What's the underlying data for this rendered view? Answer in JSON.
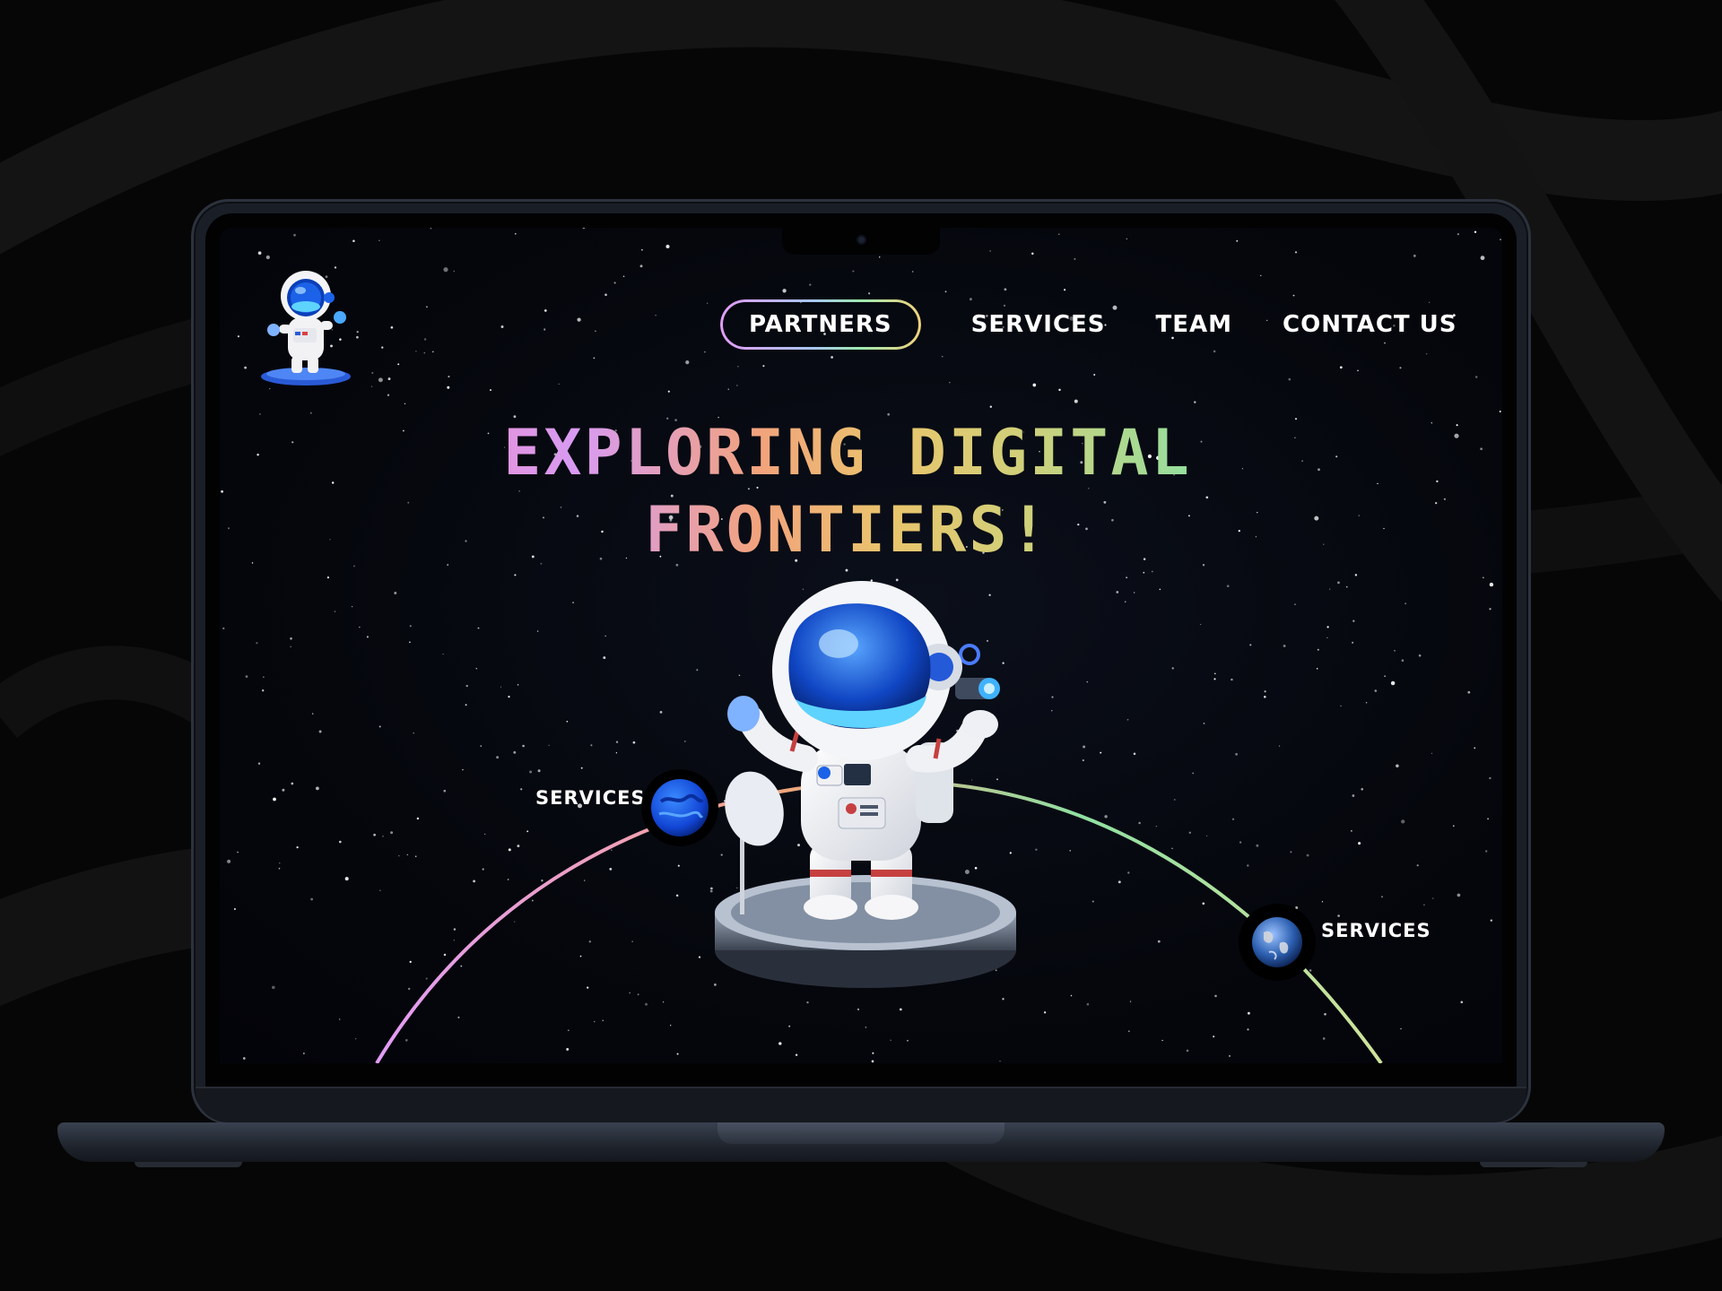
{
  "nav": {
    "items": [
      {
        "label": "PARTNERS",
        "active": true
      },
      {
        "label": "SERVICES",
        "active": false
      },
      {
        "label": "TEAM",
        "active": false
      },
      {
        "label": "CONTACT US",
        "active": false
      }
    ]
  },
  "hero": {
    "line1": "EXPLORING DIGITAL",
    "line2": "FRONTIERS!"
  },
  "orbit_nodes": [
    {
      "label": "SERVICES",
      "icon": "blue-planet-icon"
    },
    {
      "label": "SERVICES",
      "icon": "earth-planet-icon"
    }
  ],
  "colors": {
    "background": "#050505",
    "screen": "#05070d",
    "orbit_gradient": [
      "#e29cf6",
      "#f2a37c",
      "#8fe0a2",
      "#cfe39a"
    ],
    "accent_blue": "#1c62e8"
  }
}
